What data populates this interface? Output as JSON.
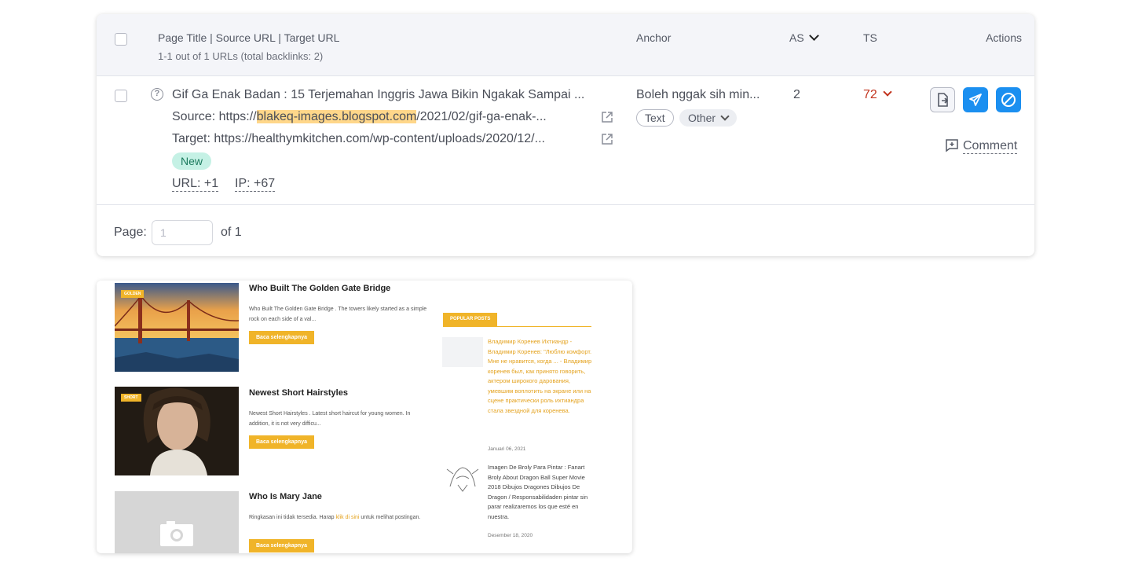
{
  "table": {
    "header": {
      "title_col": "Page Title | Source URL | Target URL",
      "subtitle": "1-1 out of 1 URLs (total backlinks: 2)",
      "anchor_col": "Anchor",
      "as_col": "AS",
      "ts_col": "TS",
      "actions_col": "Actions"
    },
    "row": {
      "page_title": "Gif Ga Enak Badan : 15 Terjemahan Inggris Jawa Bikin Ngakak Sampai ...",
      "source_label": "Source:",
      "source_prefix": "https://",
      "source_domain": "blakeq-images.blogspot.com",
      "source_path": "/2021/02/gif-ga-enak-...",
      "target_label": "Target:",
      "target_url": "https://healthymkitchen.com/wp-content/uploads/2020/12/...",
      "badge": "New",
      "url_stat": "URL: +1",
      "ip_stat": "IP: +67",
      "anchor_text": "Boleh nggak sih min...",
      "chip_text": "Text",
      "chip_other": "Other",
      "as_value": "2",
      "ts_value": "72",
      "comment": "Comment"
    },
    "pager": {
      "label": "Page:",
      "placeholder": "1",
      "of": "of 1"
    },
    "colors": {
      "accent": "#1b8ff0",
      "ts_red": "#c2341e",
      "badge_bg": "#c5f1e5",
      "highlight": "#ffd78a"
    }
  },
  "blog": {
    "posts": [
      {
        "tag": "GOLDEN",
        "title": "Who Built The Golden Gate Bridge",
        "excerpt": "Who Built The Golden Gate Bridge . The towers likely started as a simple rock on each side of a val...",
        "button": "Baca selengkapnya"
      },
      {
        "tag": "SHORT",
        "title": "Newest Short Hairstyles",
        "excerpt": "Newest Short Hairstyles . Latest short haircut for young women. In addition, it is not very difficu...",
        "button": "Baca selengkapnya"
      },
      {
        "title": "Who Is Mary Jane",
        "excerpt_pre": "Ringkasan ini tidak tersedia. Harap ",
        "excerpt_link": "klik di sini",
        "excerpt_post": " untuk melihat postingan.",
        "button": "Baca selengkapnya"
      }
    ],
    "popular": {
      "heading": "POPULAR POSTS",
      "items": [
        {
          "text": "Владимир Коренев Ихтиандр - Владимир Коренев: \"Люблю комфорт. Мне не нравится, когда ... - Владимир коренев был, как принято говорить, актером широкого дарования, умевшим воплотить на экране или на сцене практически роль ихтиандра стала звездной для коренева.",
          "date": "Januari 06, 2021"
        },
        {
          "text": "Imagen De Broly Para Pintar : Fanart Broly About Dragon Ball Super Movie 2018 Dibujos Dragones Dibujos De Dragon / Responsabilidaden pintar sin parar realizaremos los que esté en nuestra.",
          "date": "Desember 18, 2020"
        }
      ]
    },
    "colors": {
      "accent": "#f0b429"
    }
  }
}
